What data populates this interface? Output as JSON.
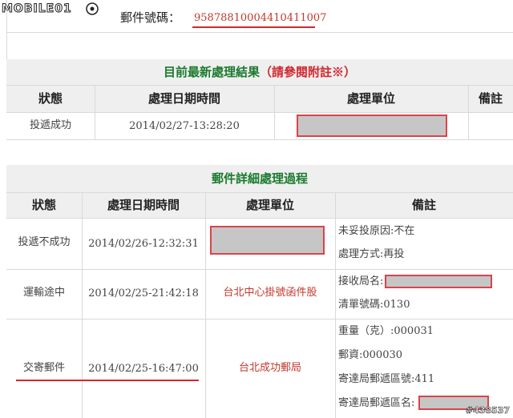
{
  "site": {
    "logo_text": "MOBILE01",
    "watermark": "#438537"
  },
  "tracking": {
    "label": "郵件號碼：",
    "number": "95878810004410411007"
  },
  "latest": {
    "title": "目前最新處理結果",
    "title_note": "（請參閱附註※）",
    "headers": [
      "狀態",
      "處理日期時間",
      "處理單位",
      "備註"
    ],
    "row": {
      "status": "投遞成功",
      "datetime": "2014/02/27-13:28:20"
    }
  },
  "detail": {
    "title": "郵件詳細處理過程",
    "headers": [
      "狀態",
      "處理日期時間",
      "處理單位",
      "備註"
    ],
    "rows": [
      {
        "status": "投遞不成功",
        "datetime": "2014/02/26-12:32:31",
        "unit": "",
        "notes": [
          "未妥投原因:不在",
          "處理方式:再投"
        ]
      },
      {
        "status": "運輸途中",
        "datetime": "2014/02/25-21:42:18",
        "unit": "台北中心掛號函件股",
        "notes": [
          "接收局名:",
          "清單號碼:0130"
        ]
      },
      {
        "status": "交寄郵件",
        "datetime": "2014/02/25-16:47:00",
        "unit": "台北成功郵局",
        "notes": [
          "重量（克）:000031",
          "郵資:000030",
          "寄達局郵遞區號:411",
          "寄達局郵遞區名:"
        ]
      }
    ]
  },
  "colors": {
    "accent_green": "#1a7a2e",
    "accent_red": "#d0282e",
    "band_gray": "#efefef"
  }
}
